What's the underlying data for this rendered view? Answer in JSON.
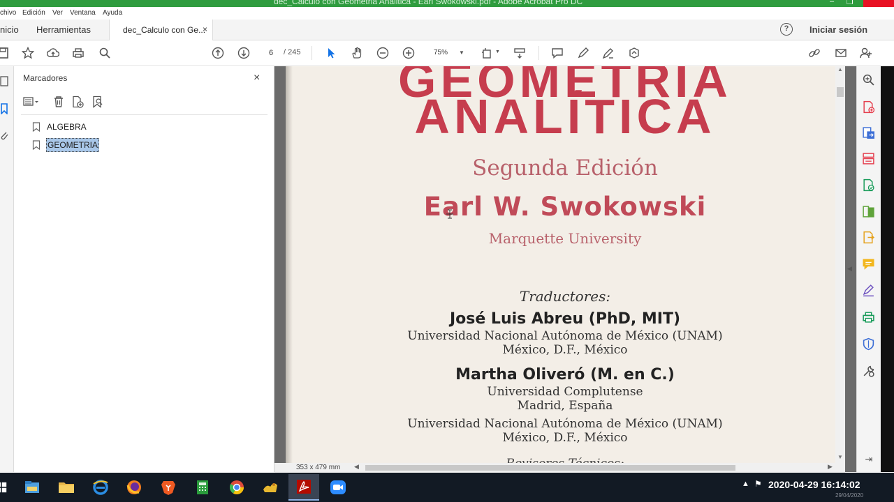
{
  "window": {
    "title": "dec_Calculo con Geometria Analitica - Earl Swokowski.pdf - Adobe Acrobat Pro DC"
  },
  "menu": [
    "chivo",
    "Edición",
    "Ver",
    "Ventana",
    "Ayuda"
  ],
  "tabs": {
    "home": "nicio",
    "tools": "Herramientas",
    "doc": "dec_Calculo con Ge...",
    "doc_close": "×",
    "signin": "Iniciar sesión",
    "help": "?"
  },
  "toolbar": {
    "page_current": "6",
    "page_total": "/ 245",
    "zoom": "75%"
  },
  "bookmarks": {
    "title": "Marcadores",
    "close": "×",
    "items": [
      {
        "label": "ALGEBRA",
        "selected": false
      },
      {
        "label": "GEOMETRIA",
        "selected": true
      }
    ]
  },
  "document": {
    "title_line1": "GEOMETRIA",
    "title_line2": "ANALÍTICA",
    "edition": "Segunda Edición",
    "author": "Earl W. Swokowski",
    "university": "Marquette University",
    "translators_heading": "Traductores:",
    "translator1": "José Luis Abreu (PhD, MIT)",
    "translator1_line1": "Universidad Nacional Autónoma de México (UNAM)",
    "translator1_line2": "México, D.F., México",
    "translator2": "Martha Oliveró (M. en C.)",
    "translator2_line1": "Universidad Complutense",
    "translator2_line2": "Madrid, España",
    "translator2_line3": "Universidad Nacional Autónoma de México (UNAM)",
    "translator2_line4": "México, D.F., México",
    "next_heading_partial": "Revisores Técnicos:"
  },
  "status": {
    "page_size": "353 x 479 mm"
  },
  "taskbar": {
    "datetime": "2020-04-29 16:14:02",
    "date_small": "29/04/2020"
  },
  "colors": {
    "title_red": "#c63d4e",
    "titlebar_green": "#2f9c3f",
    "taskbar": "#121a24",
    "selection": "#a9c7e8"
  }
}
